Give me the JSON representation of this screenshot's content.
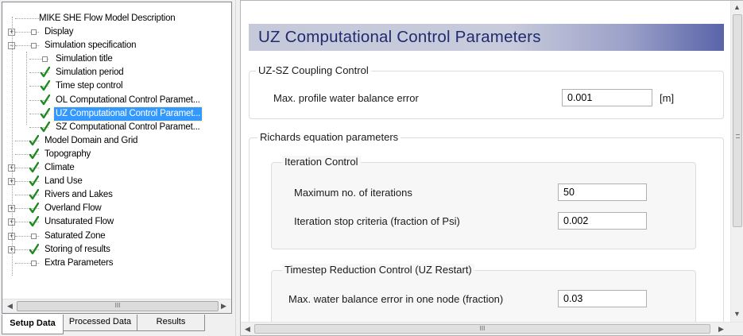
{
  "tree": {
    "items": [
      {
        "label": "MIKE SHE Flow Model Description"
      },
      {
        "label": "Display"
      },
      {
        "label": "Simulation specification"
      },
      {
        "label": "Simulation title"
      },
      {
        "label": "Simulation period"
      },
      {
        "label": "Time step control"
      },
      {
        "label": "OL Computational Control Paramet..."
      },
      {
        "label": "UZ Computational Control Paramet..."
      },
      {
        "label": "SZ Computational Control Paramet..."
      },
      {
        "label": "Model Domain and Grid"
      },
      {
        "label": "Topography"
      },
      {
        "label": "Climate"
      },
      {
        "label": "Land Use"
      },
      {
        "label": "Rivers and Lakes"
      },
      {
        "label": "Overland Flow"
      },
      {
        "label": "Unsaturated Flow"
      },
      {
        "label": "Saturated Zone"
      },
      {
        "label": "Storing of results"
      },
      {
        "label": "Extra Parameters"
      }
    ],
    "scroll_thumb_glyph": "III"
  },
  "tabs": [
    {
      "label": "Setup Data"
    },
    {
      "label": "Processed Data"
    },
    {
      "label": "Results"
    }
  ],
  "panel": {
    "title": "UZ Computational Control Parameters",
    "coupling": {
      "legend": "UZ-SZ Coupling Control",
      "label": "Max. profile water balance error",
      "value": "0.001",
      "unit": "[m]"
    },
    "richards": {
      "legend": "Richards equation parameters",
      "iteration": {
        "legend": "Iteration Control",
        "max_iter_label": "Maximum no. of iterations",
        "max_iter_value": "50",
        "stop_label": "Iteration stop criteria (fraction of Psi)",
        "stop_value": "0.002"
      },
      "timestep": {
        "legend": "Timestep Reduction Control (UZ Restart)",
        "label": "Max. water balance error in one node (fraction)",
        "value": "0.03"
      }
    },
    "hscroll_glyph": "III"
  },
  "colors": {
    "selection": "#3399ff",
    "header_gradient_end": "#5a63a8",
    "header_text": "#1f2b6e",
    "check_green": "#1f8a1f"
  }
}
